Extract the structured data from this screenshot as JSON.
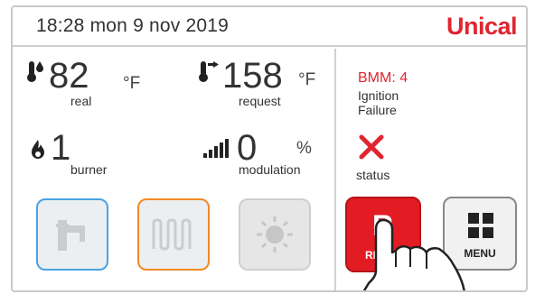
{
  "header": {
    "datetime": "18:28  mon 9 nov 2019",
    "brand": "Unical"
  },
  "readings": {
    "real": {
      "value": "82",
      "unit": "°F",
      "caption": "real",
      "icon": "thermometer-water-icon"
    },
    "request": {
      "value": "158",
      "unit": "°F",
      "caption": "request",
      "icon": "thermometer-setpoint-icon"
    },
    "burner": {
      "value": "1",
      "caption": "burner",
      "icon": "flame-icon"
    },
    "modulation": {
      "value": "0",
      "unit": "%",
      "caption": "modulation",
      "icon": "signal-bars-icon"
    }
  },
  "tiles": {
    "dhw": {
      "icon": "faucet-icon",
      "color": "#4aa3e2"
    },
    "heating": {
      "icon": "radiator-icon",
      "color": "#f28a24"
    },
    "sun": {
      "icon": "sun-icon",
      "color": "#cfcfcf"
    }
  },
  "alarm": {
    "code": "BMM: 4",
    "message_line1": "Ignition",
    "message_line2": "Failure",
    "status_icon": "error-x-icon",
    "status_label": "status"
  },
  "buttons": {
    "reset_letter": "R",
    "reset_label": "RESET",
    "menu_label": "MENU"
  },
  "colors": {
    "accent": "#e1252f",
    "text": "#333333",
    "divider": "#d0d0d0"
  }
}
